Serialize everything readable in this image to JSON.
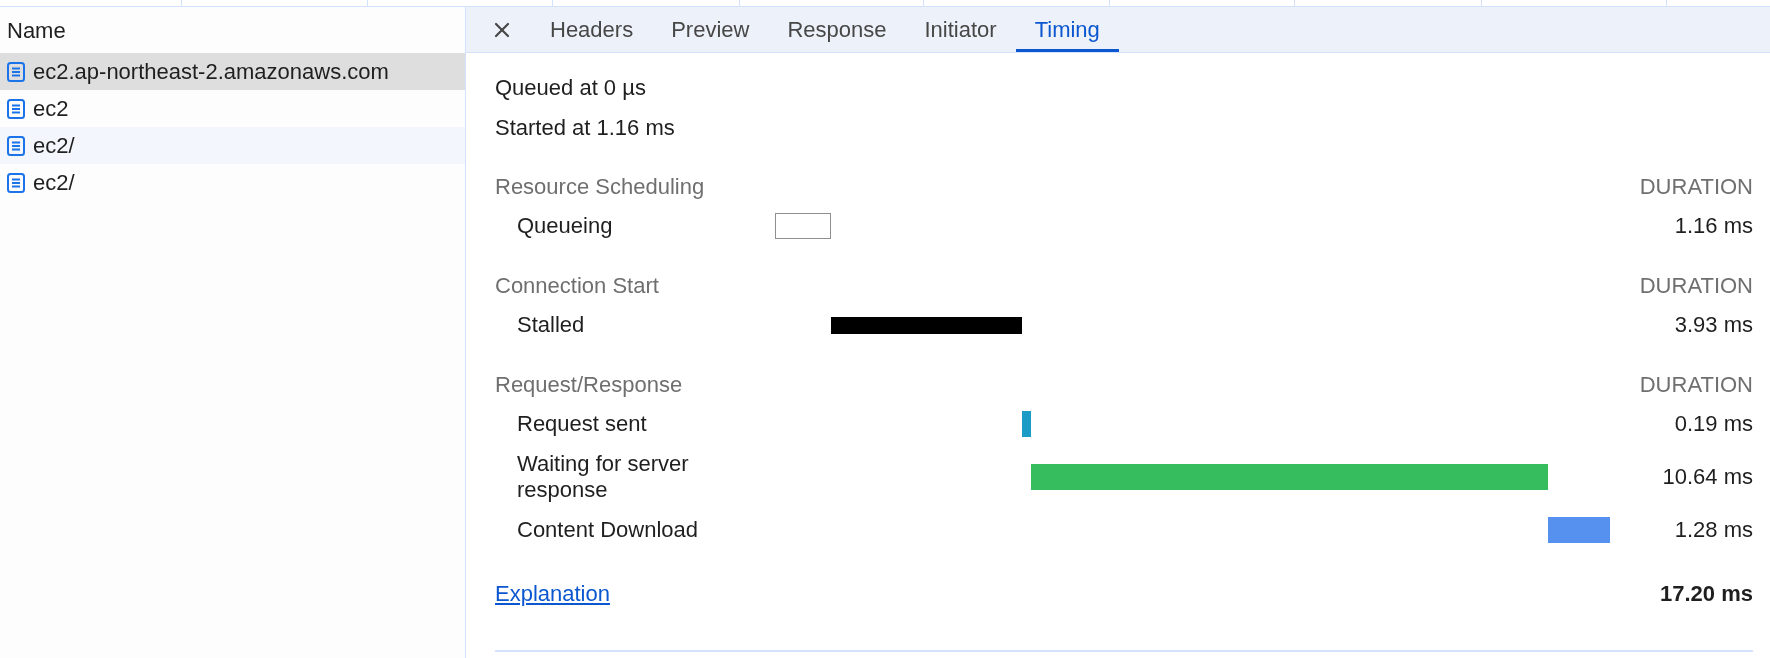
{
  "request_list": {
    "header": "Name",
    "rows": [
      {
        "name": "ec2.ap-northeast-2.amazonaws.com",
        "selected": true
      },
      {
        "name": "ec2",
        "selected": false
      },
      {
        "name": "ec2/",
        "selected": false
      },
      {
        "name": "ec2/",
        "selected": false
      }
    ]
  },
  "tabs": [
    {
      "label": "Headers",
      "selected": false
    },
    {
      "label": "Preview",
      "selected": false
    },
    {
      "label": "Response",
      "selected": false
    },
    {
      "label": "Initiator",
      "selected": false
    },
    {
      "label": "Timing",
      "selected": true
    }
  ],
  "timing": {
    "queued_at": "Queued at 0 µs",
    "started_at": "Started at 1.16 ms",
    "sections": [
      {
        "title": "Resource Scheduling",
        "column_heading": "DURATION",
        "rows": [
          {
            "label": "Queueing",
            "kind": "outline",
            "color": "#ffffff",
            "duration": "1.16 ms"
          }
        ]
      },
      {
        "title": "Connection Start",
        "column_heading": "DURATION",
        "rows": [
          {
            "label": "Stalled",
            "kind": "thin",
            "color": "#000000",
            "duration": "3.93 ms"
          }
        ]
      },
      {
        "title": "Request/Response",
        "column_heading": "DURATION",
        "rows": [
          {
            "label": "Request sent",
            "kind": "solid",
            "color": "#1a9cc6",
            "duration": "0.19 ms"
          },
          {
            "label": "Waiting for server response",
            "kind": "solid",
            "color": "#36bd5e",
            "duration": "10.64 ms"
          },
          {
            "label": "Content Download",
            "kind": "solid",
            "color": "#5691f0",
            "duration": "1.28 ms"
          }
        ]
      }
    ],
    "explanation_link": "Explanation",
    "total": "17.20 ms"
  }
}
